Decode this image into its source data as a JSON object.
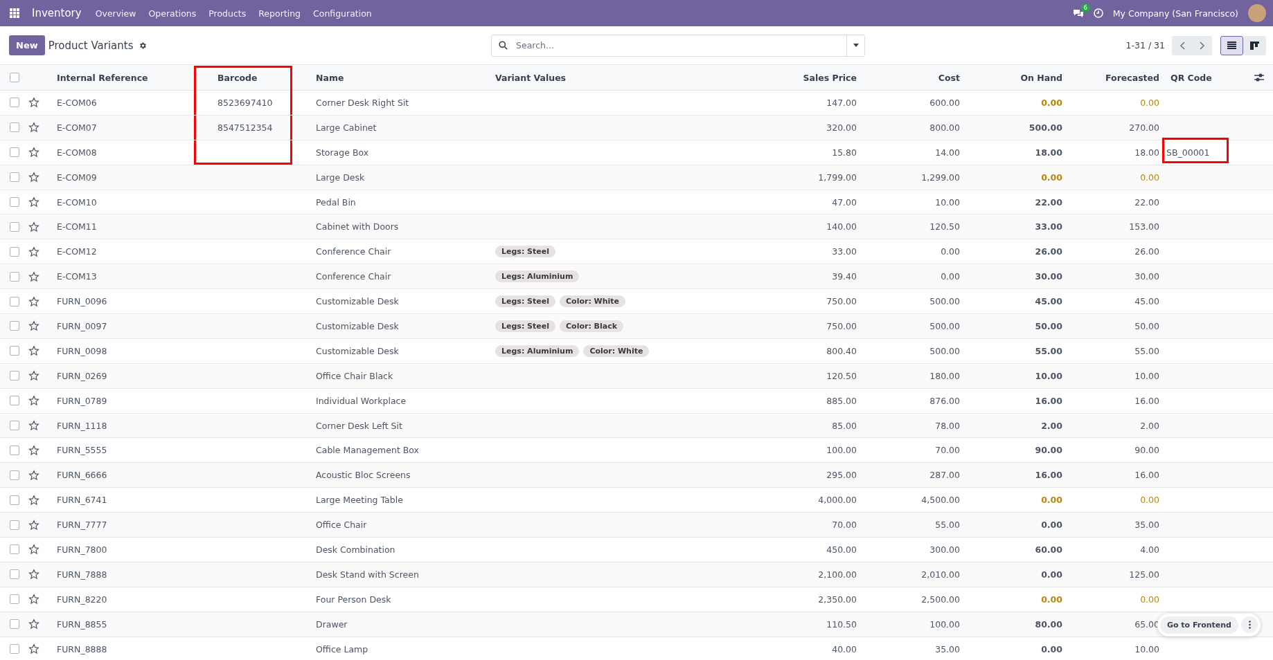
{
  "navbar": {
    "app": "Inventory",
    "menu": [
      "Overview",
      "Operations",
      "Products",
      "Reporting",
      "Configuration"
    ],
    "message_count": "6",
    "company": "My Company (San Francisco)"
  },
  "control_panel": {
    "new_button": "New",
    "title": "Product Variants",
    "search": {
      "placeholder": "Search..."
    },
    "pager": "1-31 / 31",
    "views": [
      {
        "kind": "list",
        "selected": true
      },
      {
        "kind": "kanban",
        "selected": false
      }
    ]
  },
  "table": {
    "select_all": {
      "checked": false
    },
    "columns": [
      {
        "label": "Internal Reference",
        "kind": "text",
        "marked": false
      },
      {
        "label": "Barcode",
        "kind": "text",
        "marked": true
      },
      {
        "label": "Name",
        "kind": "text",
        "marked": false
      },
      {
        "label": "Variant Values",
        "kind": "text",
        "marked": false
      },
      {
        "label": "Sales Price",
        "kind": "number",
        "marked": false
      },
      {
        "label": "Cost",
        "kind": "number",
        "marked": false
      },
      {
        "label": "On Hand",
        "kind": "number",
        "marked": false
      },
      {
        "label": "Forecasted",
        "kind": "number",
        "marked": false
      },
      {
        "label": "QR Code",
        "kind": "text",
        "marked": false
      }
    ],
    "rows": [
      {
        "checked": false,
        "starred": false,
        "reference": "E-COM06",
        "barcode": "8523697410",
        "name": "Corner Desk Right Sit",
        "variants": [],
        "sales_price": "147.00",
        "cost": "600.00",
        "on_hand": "0.00",
        "forecasted": "0.00",
        "warning": true,
        "barcode_marked": true,
        "qr_marked": false
      },
      {
        "checked": false,
        "starred": false,
        "reference": "E-COM07",
        "barcode": "8547512354",
        "name": "Large Cabinet",
        "variants": [],
        "sales_price": "320.00",
        "cost": "800.00",
        "on_hand": "500.00",
        "forecasted": "270.00",
        "warning": false,
        "barcode_marked": true,
        "qr_marked": false
      },
      {
        "checked": false,
        "starred": false,
        "reference": "E-COM08",
        "name": "Storage Box",
        "variants": [],
        "sales_price": "15.80",
        "cost": "14.00",
        "on_hand": "18.00",
        "forecasted": "18.00",
        "qr_code": "SB_00001",
        "warning": false,
        "barcode_marked": true,
        "qr_marked": true
      },
      {
        "checked": false,
        "starred": false,
        "reference": "E-COM09",
        "name": "Large Desk",
        "variants": [],
        "sales_price": "1,799.00",
        "cost": "1,299.00",
        "on_hand": "0.00",
        "forecasted": "0.00",
        "warning": true,
        "barcode_marked": false,
        "qr_marked": false
      },
      {
        "checked": false,
        "starred": false,
        "reference": "E-COM10",
        "name": "Pedal Bin",
        "variants": [],
        "sales_price": "47.00",
        "cost": "10.00",
        "on_hand": "22.00",
        "forecasted": "22.00",
        "warning": false,
        "barcode_marked": false,
        "qr_marked": false
      },
      {
        "checked": false,
        "starred": false,
        "reference": "E-COM11",
        "name": "Cabinet with Doors",
        "variants": [],
        "sales_price": "140.00",
        "cost": "120.50",
        "on_hand": "33.00",
        "forecasted": "153.00",
        "warning": false,
        "barcode_marked": false,
        "qr_marked": false
      },
      {
        "checked": false,
        "starred": false,
        "reference": "E-COM12",
        "name": "Conference Chair",
        "variants": [
          "Legs: Steel"
        ],
        "sales_price": "33.00",
        "cost": "0.00",
        "on_hand": "26.00",
        "forecasted": "26.00",
        "warning": false,
        "barcode_marked": false,
        "qr_marked": false
      },
      {
        "checked": false,
        "starred": false,
        "reference": "E-COM13",
        "name": "Conference Chair",
        "variants": [
          "Legs: Aluminium"
        ],
        "sales_price": "39.40",
        "cost": "0.00",
        "on_hand": "30.00",
        "forecasted": "30.00",
        "warning": false,
        "barcode_marked": false,
        "qr_marked": false
      },
      {
        "checked": false,
        "starred": false,
        "reference": "FURN_0096",
        "name": "Customizable Desk",
        "variants": [
          "Legs: Steel",
          "Color: White"
        ],
        "sales_price": "750.00",
        "cost": "500.00",
        "on_hand": "45.00",
        "forecasted": "45.00",
        "warning": false,
        "barcode_marked": false,
        "qr_marked": false
      },
      {
        "checked": false,
        "starred": false,
        "reference": "FURN_0097",
        "name": "Customizable Desk",
        "variants": [
          "Legs: Steel",
          "Color: Black"
        ],
        "sales_price": "750.00",
        "cost": "500.00",
        "on_hand": "50.00",
        "forecasted": "50.00",
        "warning": false,
        "barcode_marked": false,
        "qr_marked": false
      },
      {
        "checked": false,
        "starred": false,
        "reference": "FURN_0098",
        "name": "Customizable Desk",
        "variants": [
          "Legs: Aluminium",
          "Color: White"
        ],
        "sales_price": "800.40",
        "cost": "500.00",
        "on_hand": "55.00",
        "forecasted": "55.00",
        "warning": false,
        "barcode_marked": false,
        "qr_marked": false
      },
      {
        "checked": false,
        "starred": false,
        "reference": "FURN_0269",
        "name": "Office Chair Black",
        "variants": [],
        "sales_price": "120.50",
        "cost": "180.00",
        "on_hand": "10.00",
        "forecasted": "10.00",
        "warning": false,
        "barcode_marked": false,
        "qr_marked": false
      },
      {
        "checked": false,
        "starred": false,
        "reference": "FURN_0789",
        "name": "Individual Workplace",
        "variants": [],
        "sales_price": "885.00",
        "cost": "876.00",
        "on_hand": "16.00",
        "forecasted": "16.00",
        "warning": false,
        "barcode_marked": false,
        "qr_marked": false
      },
      {
        "checked": false,
        "starred": false,
        "reference": "FURN_1118",
        "name": "Corner Desk Left Sit",
        "variants": [],
        "sales_price": "85.00",
        "cost": "78.00",
        "on_hand": "2.00",
        "forecasted": "2.00",
        "warning": false,
        "barcode_marked": false,
        "qr_marked": false
      },
      {
        "checked": false,
        "starred": false,
        "reference": "FURN_5555",
        "name": "Cable Management Box",
        "variants": [],
        "sales_price": "100.00",
        "cost": "70.00",
        "on_hand": "90.00",
        "forecasted": "90.00",
        "warning": false,
        "barcode_marked": false,
        "qr_marked": false
      },
      {
        "checked": false,
        "starred": false,
        "reference": "FURN_6666",
        "name": "Acoustic Bloc Screens",
        "variants": [],
        "sales_price": "295.00",
        "cost": "287.00",
        "on_hand": "16.00",
        "forecasted": "16.00",
        "warning": false,
        "barcode_marked": false,
        "qr_marked": false
      },
      {
        "checked": false,
        "starred": false,
        "reference": "FURN_6741",
        "name": "Large Meeting Table",
        "variants": [],
        "sales_price": "4,000.00",
        "cost": "4,500.00",
        "on_hand": "0.00",
        "forecasted": "0.00",
        "warning": true,
        "barcode_marked": false,
        "qr_marked": false
      },
      {
        "checked": false,
        "starred": false,
        "reference": "FURN_7777",
        "name": "Office Chair",
        "variants": [],
        "sales_price": "70.00",
        "cost": "55.00",
        "on_hand": "0.00",
        "forecasted": "35.00",
        "warning": false,
        "barcode_marked": false,
        "qr_marked": false
      },
      {
        "checked": false,
        "starred": false,
        "reference": "FURN_7800",
        "name": "Desk Combination",
        "variants": [],
        "sales_price": "450.00",
        "cost": "300.00",
        "on_hand": "60.00",
        "forecasted": "4.00",
        "warning": false,
        "barcode_marked": false,
        "qr_marked": false
      },
      {
        "checked": false,
        "starred": false,
        "reference": "FURN_7888",
        "name": "Desk Stand with Screen",
        "variants": [],
        "sales_price": "2,100.00",
        "cost": "2,010.00",
        "on_hand": "0.00",
        "forecasted": "125.00",
        "warning": false,
        "barcode_marked": false,
        "qr_marked": false
      },
      {
        "checked": false,
        "starred": false,
        "reference": "FURN_8220",
        "name": "Four Person Desk",
        "variants": [],
        "sales_price": "2,350.00",
        "cost": "2,500.00",
        "on_hand": "0.00",
        "forecasted": "0.00",
        "warning": true,
        "barcode_marked": false,
        "qr_marked": false
      },
      {
        "checked": false,
        "starred": false,
        "reference": "FURN_8855",
        "name": "Drawer",
        "variants": [],
        "sales_price": "110.50",
        "cost": "100.00",
        "on_hand": "80.00",
        "forecasted": "65.00",
        "warning": false,
        "barcode_marked": false,
        "qr_marked": false
      },
      {
        "checked": false,
        "starred": false,
        "reference": "FURN_8888",
        "name": "Office Lamp",
        "variants": [],
        "sales_price": "40.00",
        "cost": "35.00",
        "on_hand": "0.00",
        "forecasted": "10.00",
        "warning": false,
        "barcode_marked": false,
        "qr_marked": false
      }
    ]
  },
  "floating_action": {
    "label": "Go to Frontend"
  }
}
